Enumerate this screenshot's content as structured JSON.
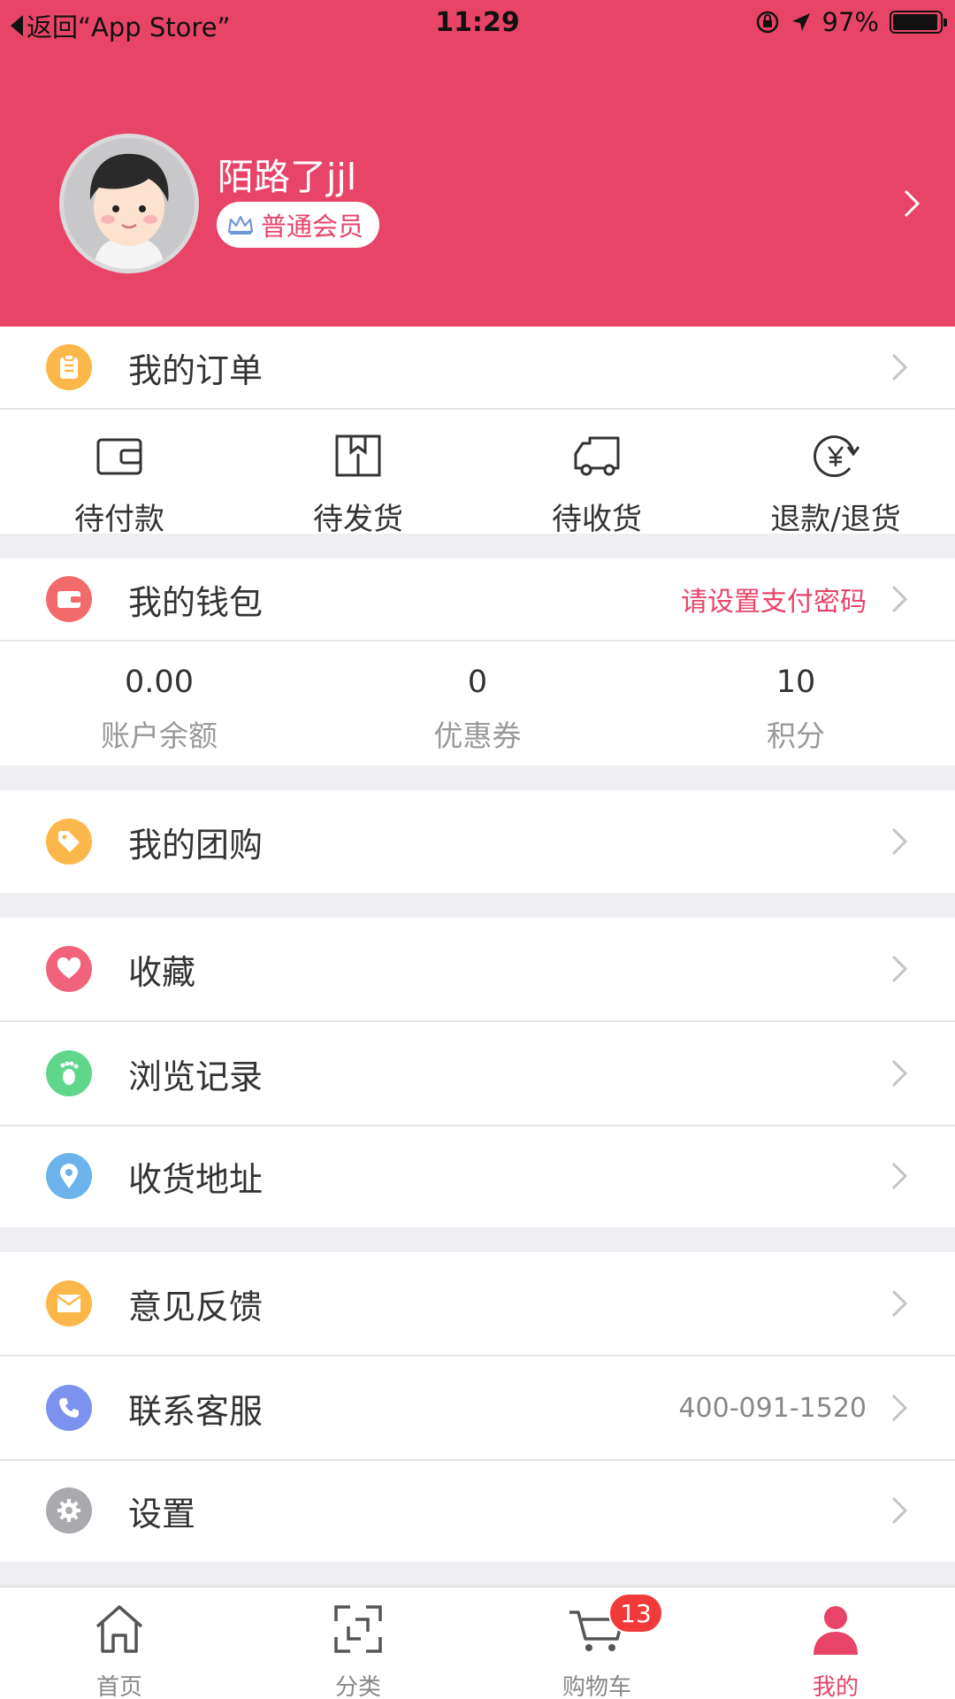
{
  "status_bar": {
    "back_text": "返回“App Store”",
    "time": "11:29",
    "battery": "97%",
    "battery_level": 0.97
  },
  "profile": {
    "username": "陌路了jjl",
    "member_level": "普通会员"
  },
  "orders": {
    "title": "我的订单",
    "items": [
      {
        "label": "待付款",
        "icon": "wallet-icon"
      },
      {
        "label": "待发货",
        "icon": "box-icon"
      },
      {
        "label": "待收货",
        "icon": "truck-icon"
      },
      {
        "label": "退款/退货",
        "icon": "refund-icon"
      }
    ]
  },
  "wallet": {
    "title": "我的钱包",
    "hint": "请设置支付密码",
    "stats": [
      {
        "value": "0.00",
        "label": "账户余额"
      },
      {
        "value": "0",
        "label": "优惠券"
      },
      {
        "value": "10",
        "label": "积分"
      }
    ]
  },
  "menu": {
    "group_buy": "我的团购",
    "favorites": "收藏",
    "history": "浏览记录",
    "address": "收货地址",
    "feedback": "意见反馈",
    "support": "联系客服",
    "support_phone": "400-091-1520",
    "settings": "设置"
  },
  "tabbar": {
    "items": [
      {
        "label": "首页",
        "icon": "home-icon"
      },
      {
        "label": "分类",
        "icon": "category-icon"
      },
      {
        "label": "购物车",
        "icon": "cart-icon",
        "badge": "13"
      },
      {
        "label": "我的",
        "icon": "profile-icon"
      }
    ]
  },
  "colors": {
    "brand": "#e84468",
    "hint": "#e84468",
    "icon_orange": "#fcb74a",
    "icon_red": "#f26a6a",
    "icon_pink": "#f0637a",
    "icon_green": "#5fd68a",
    "icon_blue": "#6bb3ea",
    "icon_purple_blue": "#7b93ee",
    "icon_gray": "#a9a9ae"
  }
}
